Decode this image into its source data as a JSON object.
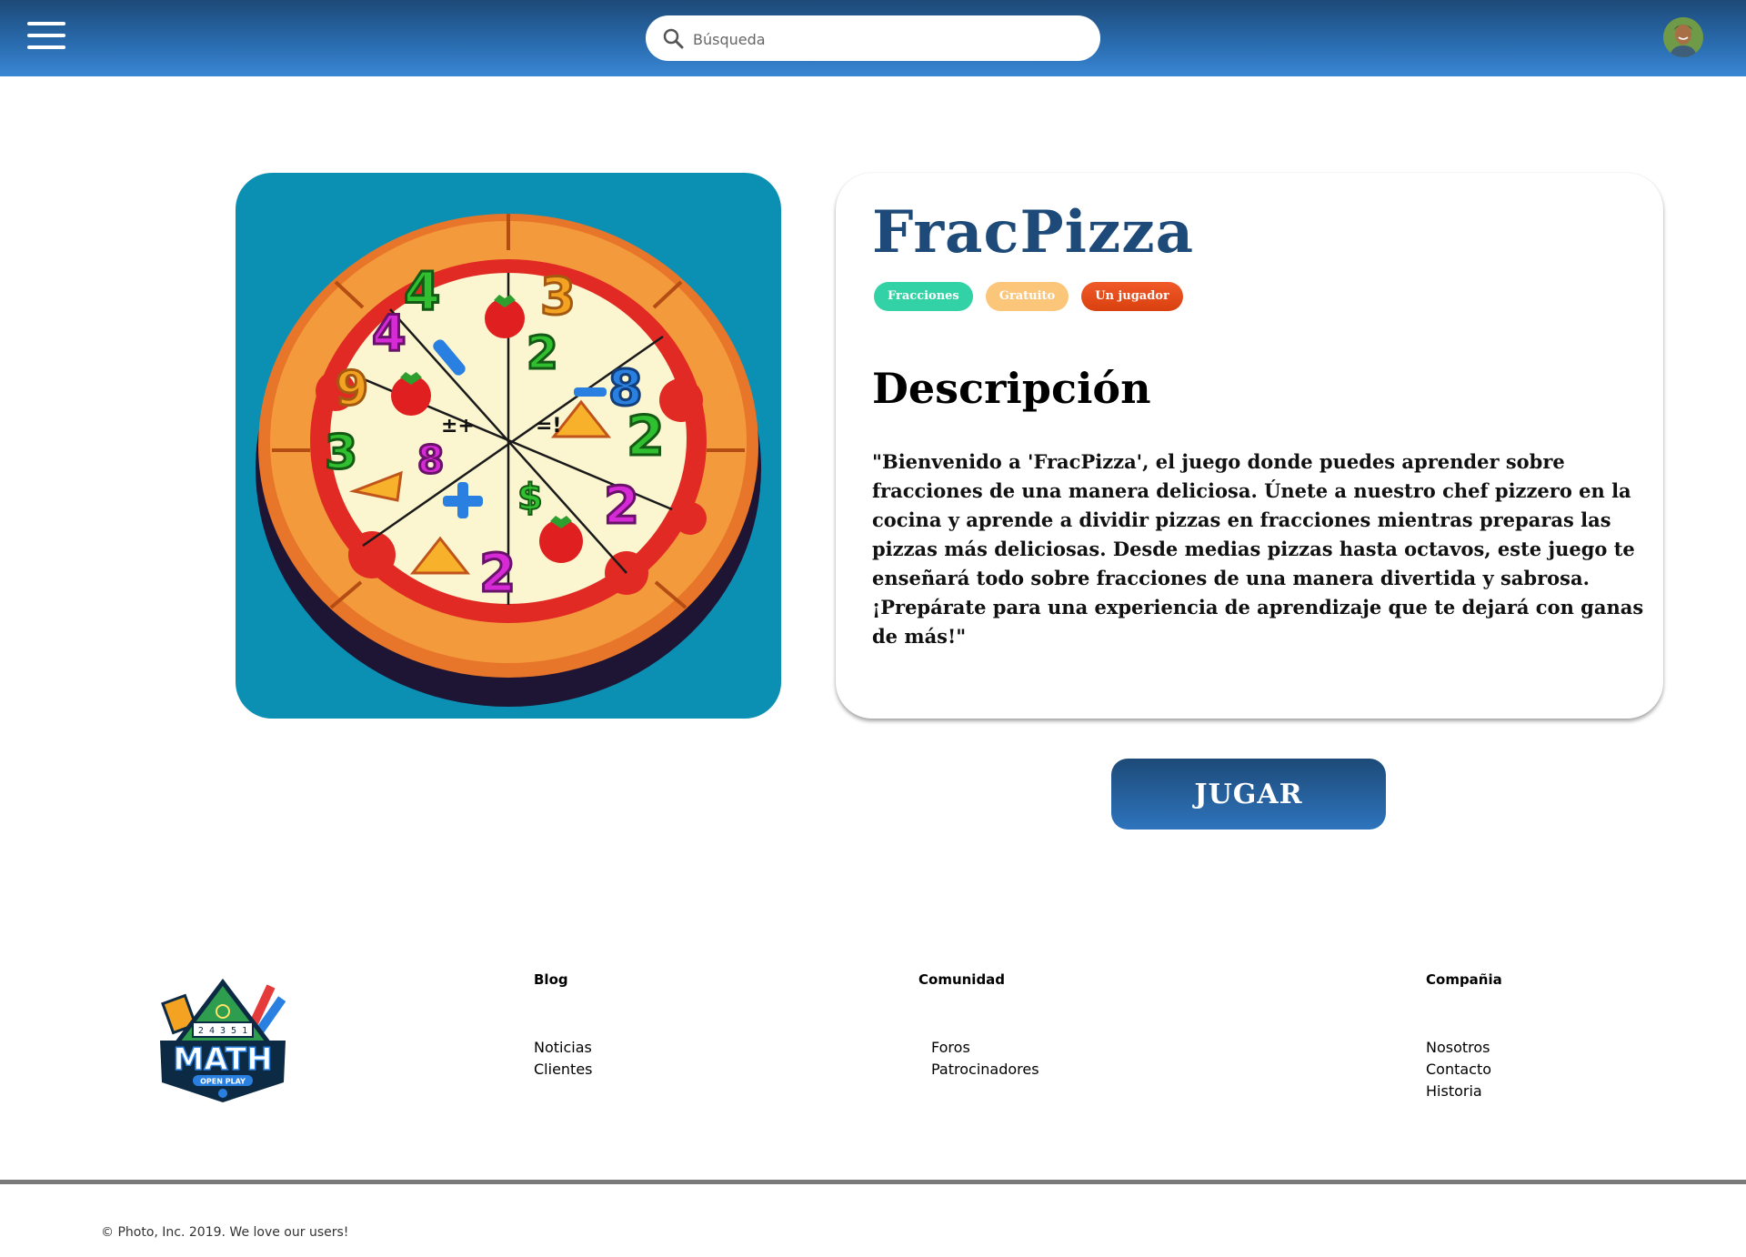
{
  "header": {
    "search_placeholder": "Búsqueda"
  },
  "game": {
    "title": "FracPizza",
    "tags": [
      {
        "label": "Fracciones",
        "color": "#33d1a6"
      },
      {
        "label": "Gratuito",
        "color": "#fbc57a"
      },
      {
        "label": "Un jugador",
        "color": "#f05a28"
      }
    ],
    "description_heading": "Descripción",
    "description": "\"Bienvenido a 'FracPizza', el juego donde puedes aprender sobre fracciones de una manera deliciosa. Únete a nuestro chef pizzero en la cocina y aprende a dividir pizzas en fracciones mientras preparas las pizzas más deliciosas. Desde medias pizzas hasta octavos, este juego te enseñará todo sobre fracciones de una manera divertida y sabrosa. ¡Prepárate para una experiencia de aprendizaje que te dejará con ganas de más!\"",
    "play_label": "JUGAR"
  },
  "logo": {
    "text": "MATH",
    "subtext": "OPEN PLAY",
    "digits": "2 4 3 5 1"
  },
  "footer": {
    "columns": [
      {
        "heading": "Blog",
        "links": [
          "Noticias",
          "Clientes"
        ]
      },
      {
        "heading": "Comunidad",
        "links": [
          "Foros",
          "Patrocinadores"
        ]
      },
      {
        "heading": "Compañia",
        "links": [
          "Nosotros",
          "Contacto",
          "Historia"
        ]
      }
    ],
    "copyright": "© Photo, Inc. 2019. We love our users!"
  },
  "colors": {
    "header_dark": "#1d4a78",
    "header_light": "#3a86d4",
    "title_blue": "#1d4a78",
    "image_background": "#0b90b3"
  },
  "icons": [
    "menu-icon",
    "search-icon",
    "user-avatar"
  ]
}
